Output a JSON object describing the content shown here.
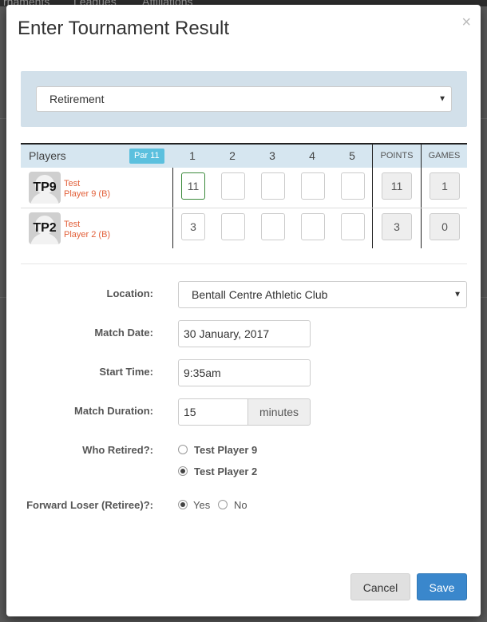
{
  "background": {
    "nav_items": [
      "rnaments",
      "Leagues",
      "Affiliations"
    ]
  },
  "modal": {
    "title": "Enter Tournament Result",
    "close_symbol": "×"
  },
  "result_type": {
    "selected": "Retirement"
  },
  "score_table": {
    "players_header": "Players",
    "par_badge": "Par 11",
    "game_headers": [
      "1",
      "2",
      "3",
      "4",
      "5"
    ],
    "points_header": "POINTS",
    "games_header": "GAMES",
    "rows": [
      {
        "initials": "TP9",
        "name_line1": "Test",
        "name_line2": "Player 9 (B)",
        "scores": [
          "11",
          "",
          "",
          "",
          ""
        ],
        "points": "11",
        "games": "1"
      },
      {
        "initials": "TP2",
        "name_line1": "Test",
        "name_line2": "Player 2 (B)",
        "scores": [
          "3",
          "",
          "",
          "",
          ""
        ],
        "points": "3",
        "games": "0"
      }
    ]
  },
  "form": {
    "location_label": "Location:",
    "location_value": "Bentall Centre Athletic Club",
    "match_date_label": "Match Date:",
    "match_date_value": "30 January, 2017",
    "start_time_label": "Start Time:",
    "start_time_value": "9:35am",
    "duration_label": "Match Duration:",
    "duration_value": "15",
    "duration_unit": "minutes",
    "who_retired_label": "Who Retired?:",
    "who_retired_options": [
      "Test Player 9",
      "Test Player 2"
    ],
    "who_retired_selected": "Test Player 2",
    "forward_loser_label": "Forward Loser (Retiree)?:",
    "forward_loser_options": [
      "Yes",
      "No"
    ],
    "forward_loser_selected": "Yes"
  },
  "footer": {
    "cancel_label": "Cancel",
    "save_label": "Save"
  },
  "colors": {
    "save_button": "#3a87cc",
    "par_badge": "#5bc0de",
    "player_name": "#e2603a",
    "panel_bg": "#d2e0ea"
  }
}
